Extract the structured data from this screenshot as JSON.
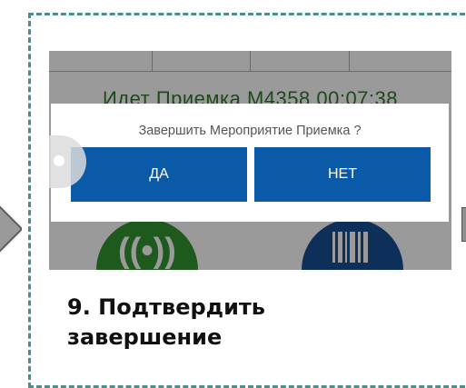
{
  "screen": {
    "background_status": "Идет Приемка М4358 00:07:38",
    "dialog": {
      "message": "Завершить Мероприятие Приемка ?",
      "yes_label": "ДА",
      "no_label": "НЕТ"
    },
    "icons": [
      "rfid-scan-icon",
      "barcode-scan-icon"
    ]
  },
  "caption": {
    "line1": "9. Подтвердить",
    "line2": "завершение"
  },
  "colors": {
    "frame_border": "#4a8f8a",
    "button_blue": "#0b5aa8",
    "green_button": "#1e5a1d",
    "blue_button": "#0d2f5a"
  }
}
